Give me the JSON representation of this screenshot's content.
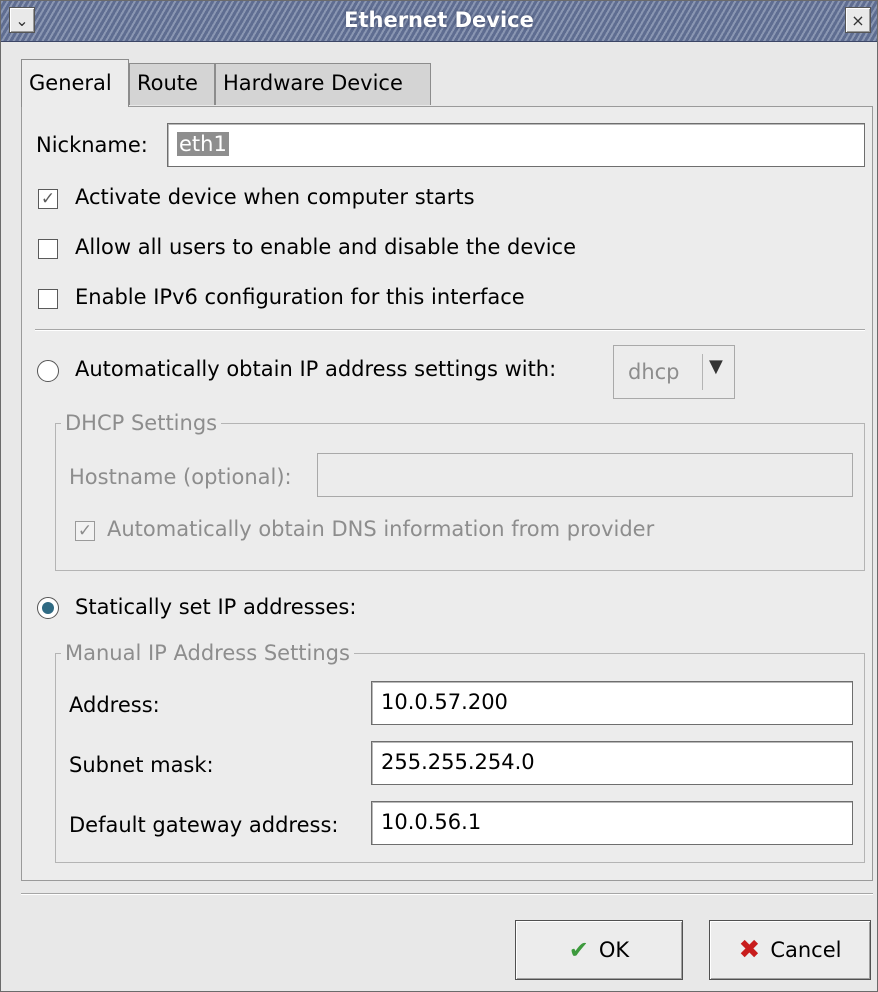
{
  "window": {
    "title": "Ethernet Device"
  },
  "tabs": [
    {
      "label": "General"
    },
    {
      "label": "Route"
    },
    {
      "label": "Hardware Device"
    }
  ],
  "general": {
    "nickname_label": "Nickname:",
    "nickname_value": "eth1",
    "activate_on_start": {
      "label": "Activate device when computer starts",
      "checked": true
    },
    "allow_users": {
      "label": "Allow all users to enable and disable the device",
      "checked": false
    },
    "enable_ipv6": {
      "label": "Enable IPv6 configuration for this interface",
      "checked": false
    },
    "auto_ip": {
      "label": "Automatically obtain IP address settings with:",
      "selected": false,
      "protocol": "dhcp"
    },
    "dhcp": {
      "title": "DHCP Settings",
      "hostname_label": "Hostname (optional):",
      "hostname_value": "",
      "auto_dns": {
        "label": "Automatically obtain DNS information from provider",
        "checked": true
      }
    },
    "static_ip": {
      "label": "Statically set IP addresses:",
      "selected": true
    },
    "manual": {
      "title": "Manual IP Address Settings",
      "address_label": "Address:",
      "address_value": "10.0.57.200",
      "subnet_label": "Subnet mask:",
      "subnet_value": "255.255.254.0",
      "gateway_label": "Default gateway address:",
      "gateway_value": "10.0.56.1"
    }
  },
  "buttons": {
    "ok": "OK",
    "cancel": "Cancel"
  }
}
